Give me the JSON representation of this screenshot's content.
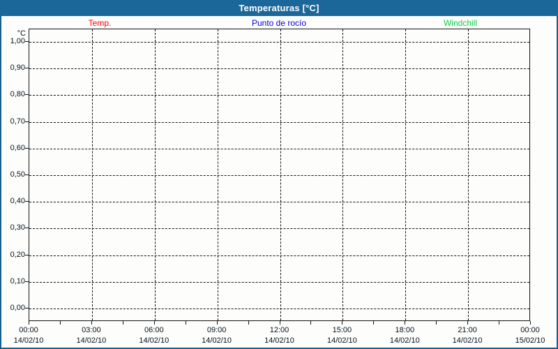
{
  "window": {
    "title": "Temperaturas [°C]"
  },
  "chart_data": {
    "type": "line",
    "title": "Temperaturas [°C]",
    "xlabel": "",
    "ylabel": "°C",
    "ylim": [
      -0.05,
      1.05
    ],
    "grid": true,
    "legend_position": "top",
    "y_tick_labels": [
      "1,00",
      "0,90",
      "0,80",
      "0,70",
      "0,60",
      "0,50",
      "0,40",
      "0,30",
      "0,20",
      "0,10",
      "0,00"
    ],
    "x_ticks": [
      {
        "time": "00:00",
        "date": "14/02/10"
      },
      {
        "time": "03:00",
        "date": "14/02/10"
      },
      {
        "time": "06:00",
        "date": "14/02/10"
      },
      {
        "time": "09:00",
        "date": "14/02/10"
      },
      {
        "time": "12:00",
        "date": "14/02/10"
      },
      {
        "time": "15:00",
        "date": "14/02/10"
      },
      {
        "time": "18:00",
        "date": "14/02/10"
      },
      {
        "time": "21:00",
        "date": "14/02/10"
      },
      {
        "time": "00:00",
        "date": "15/02/10"
      }
    ],
    "series": [
      {
        "name": "Temp.",
        "color": "#ff0000",
        "values": []
      },
      {
        "name": "Punto de rocío",
        "color": "#0000dd",
        "values": []
      },
      {
        "name": "Windchill",
        "color": "#00d23c",
        "values": []
      }
    ]
  },
  "colors": {
    "titlebar_bg": "#1b679a",
    "window_border": "#19608f",
    "grid": "#111111",
    "axis_text": "#02101c"
  }
}
